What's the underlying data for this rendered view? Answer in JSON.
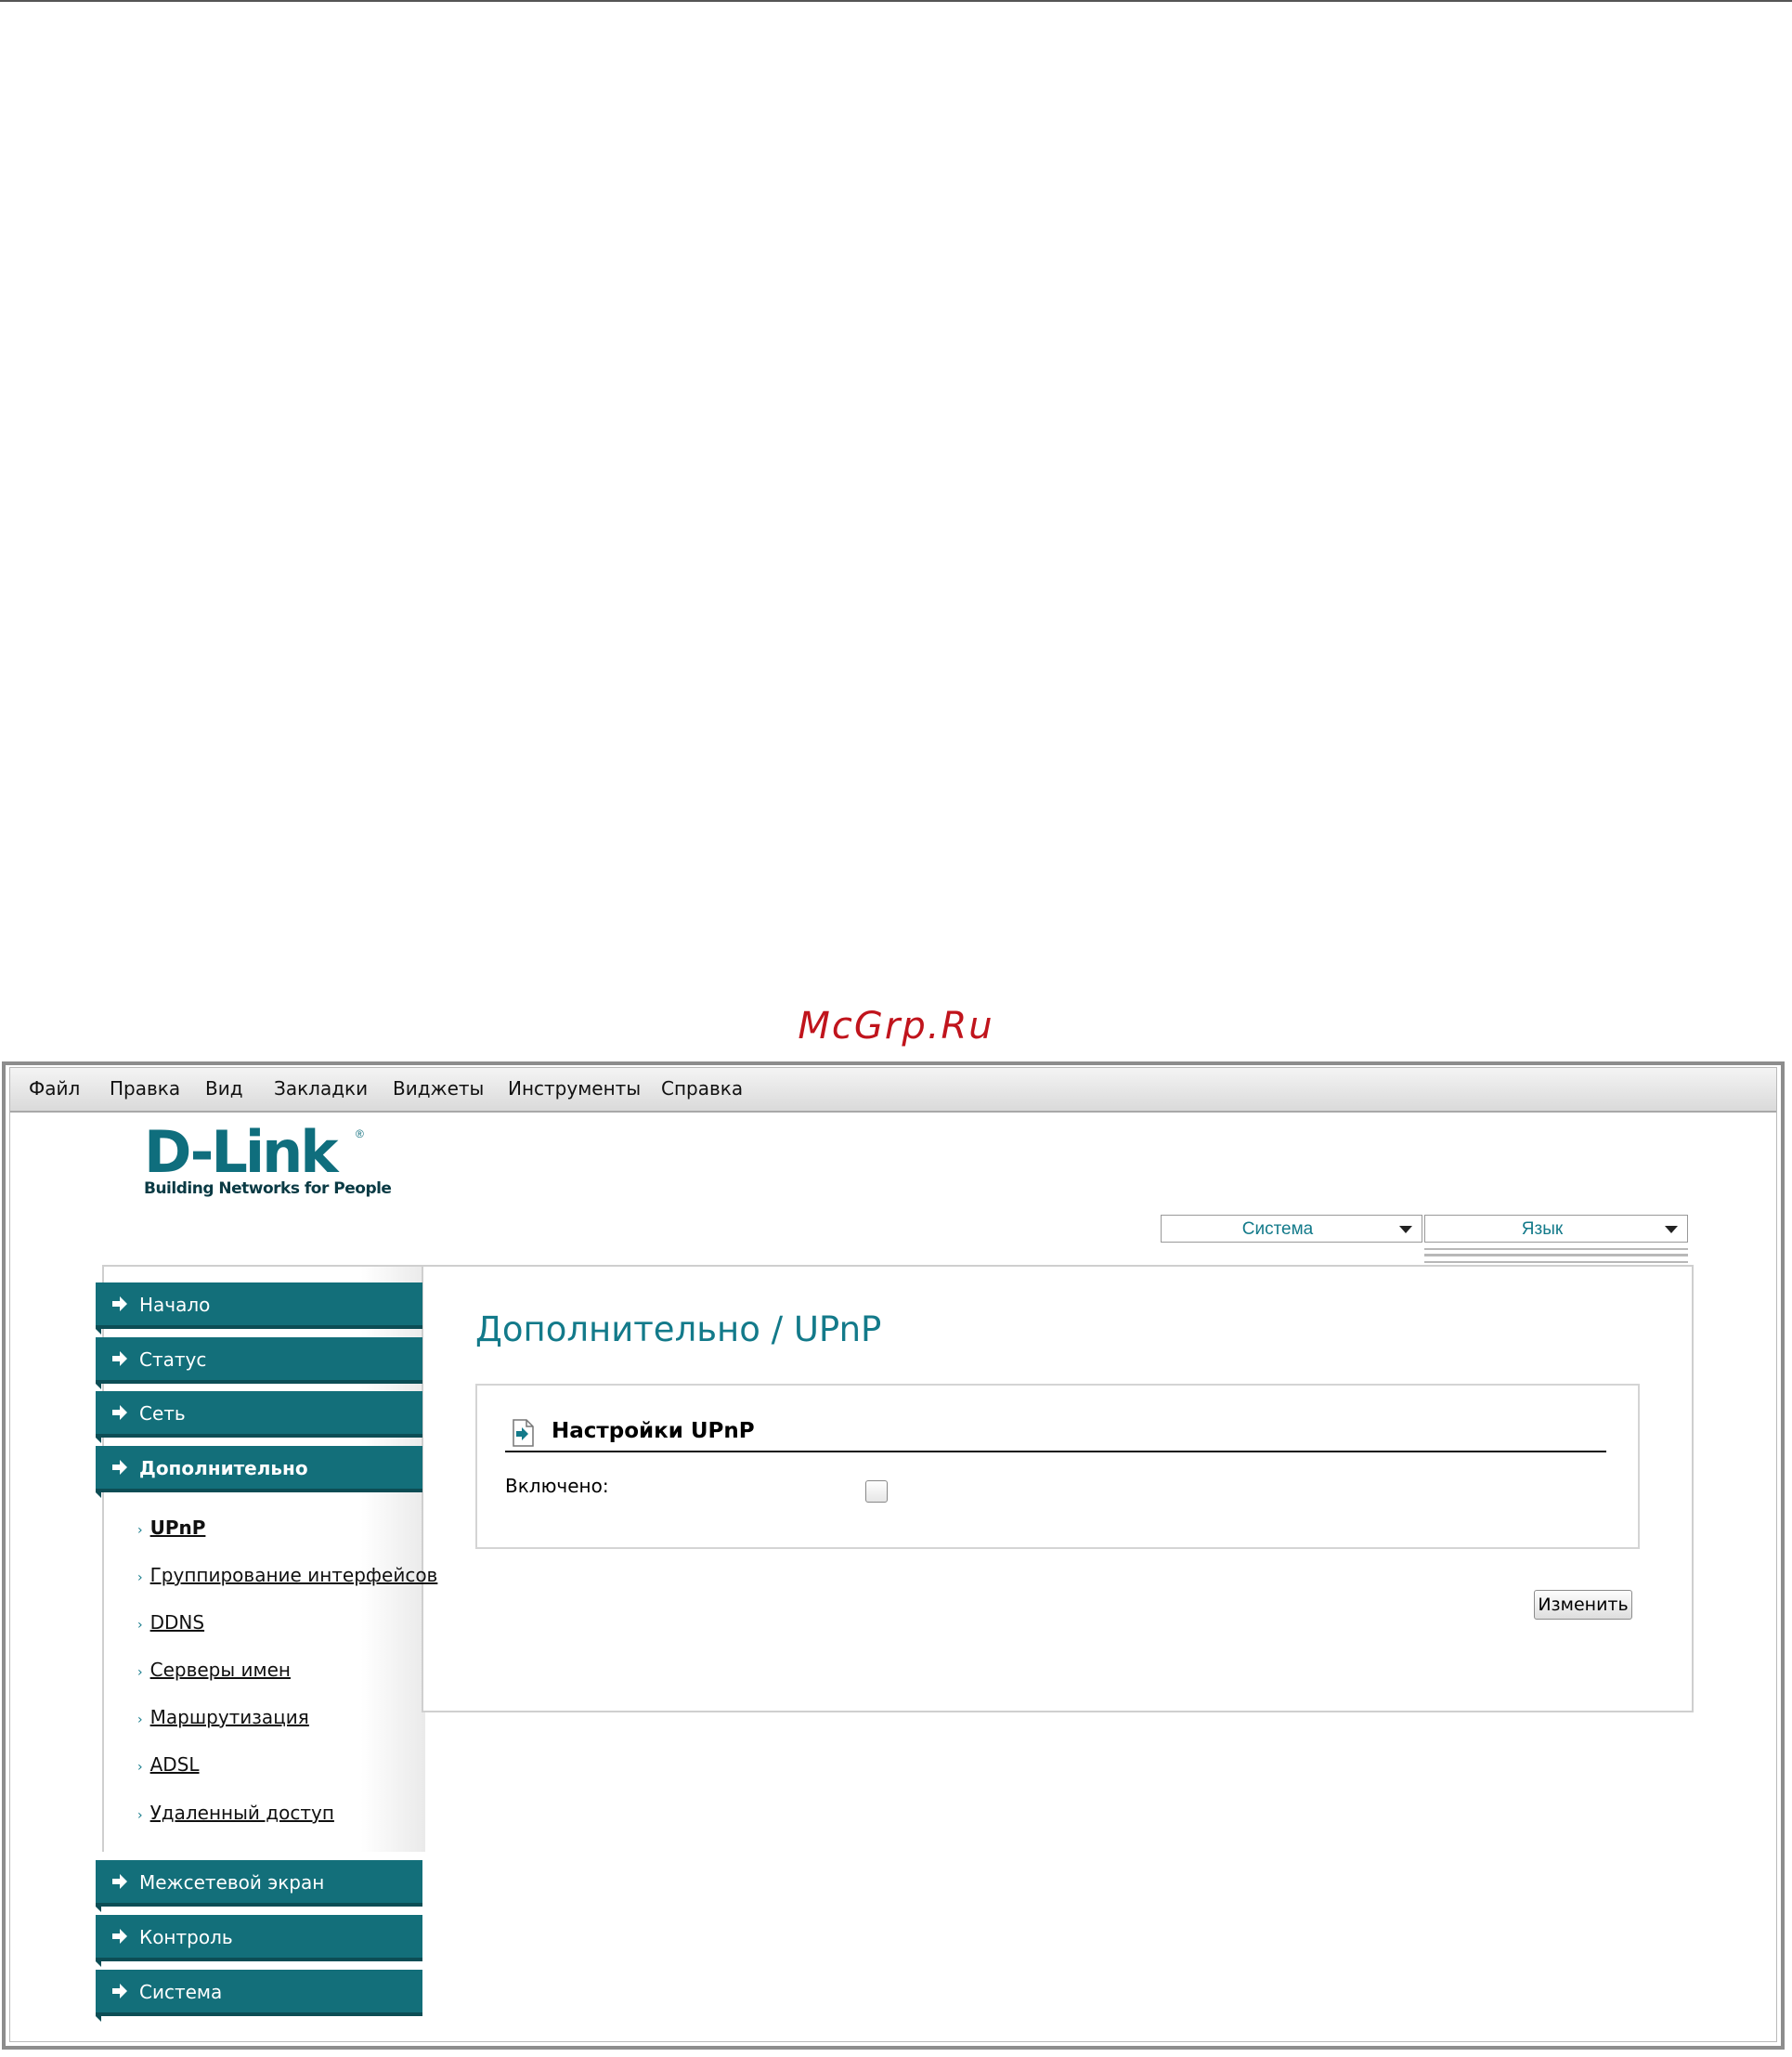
{
  "watermark": "McGrp.Ru",
  "menubar": {
    "items": [
      "Файл",
      "Правка",
      "Вид",
      "Закладки",
      "Виджеты",
      "Инструменты",
      "Справка"
    ]
  },
  "logo": {
    "word": "D-Link",
    "tagline": "Building Networks for People"
  },
  "top_selects": {
    "system": "Система",
    "language": "Язык"
  },
  "sidebar": {
    "main_items": [
      "Начало",
      "Статус",
      "Сеть",
      "Дополнительно"
    ],
    "sub_items": [
      "UPnP",
      "Группирование интерфейсов",
      "DDNS",
      "Серверы имен",
      "Маршрутизация",
      "ADSL",
      "Удаленный доступ"
    ],
    "bottom_items": [
      "Межсетевой экран",
      "Контроль",
      "Система"
    ]
  },
  "content": {
    "title": "Дополнительно /  UPnP",
    "section_title": "Настройки UPnP",
    "enabled_label": "Включено:",
    "enabled_checked": false,
    "change_button": "Изменить"
  },
  "colors": {
    "accent": "#136f7a",
    "link_teal": "#137a8a",
    "watermark": "#c0141c"
  }
}
